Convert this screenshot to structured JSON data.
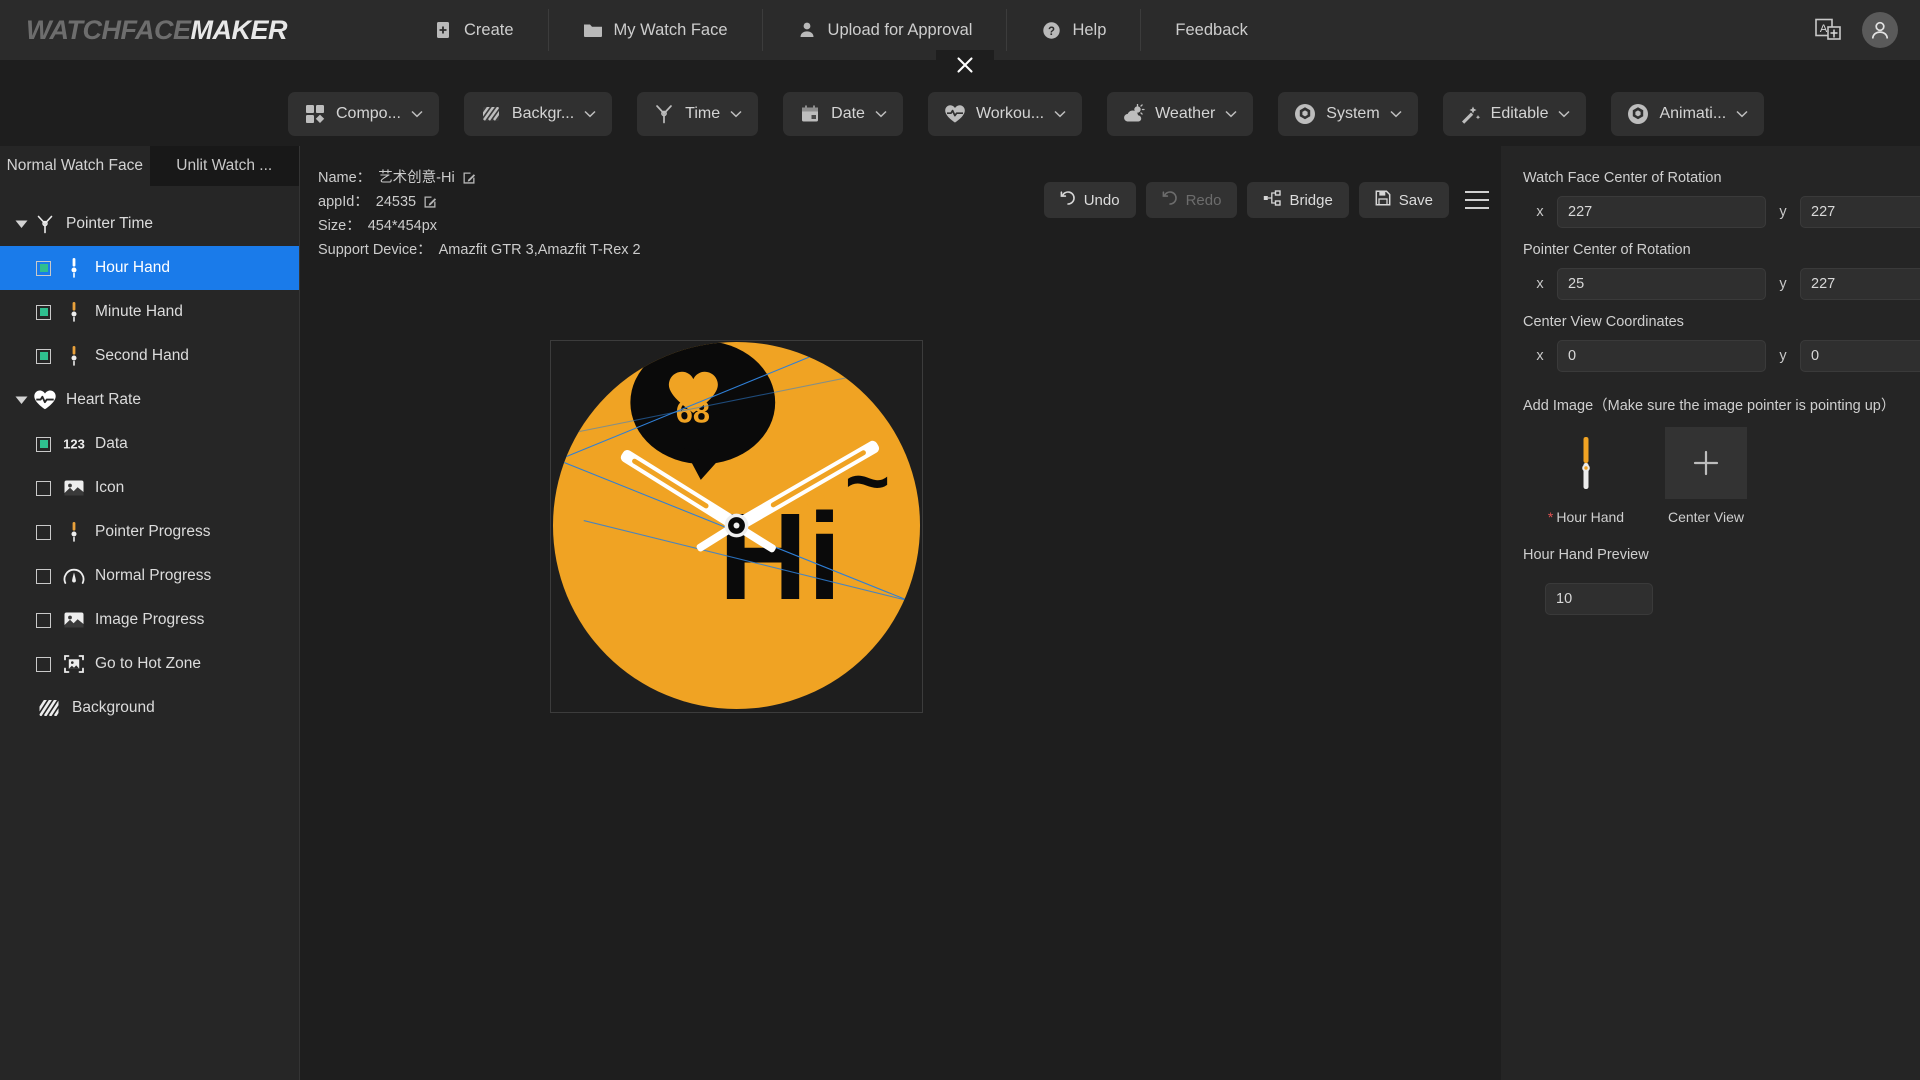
{
  "brand": {
    "part1": "WATCHFACE",
    "part2": "MAKER"
  },
  "topnav": {
    "items": [
      {
        "label": "Create",
        "icon": "file-plus-icon"
      },
      {
        "label": "My Watch Face",
        "icon": "folder-icon"
      },
      {
        "label": "Upload for Approval",
        "icon": "person-upload-icon"
      },
      {
        "label": "Help",
        "icon": "question-circle-icon"
      },
      {
        "label": "Feedback",
        "icon": "none"
      }
    ],
    "language_icon": "language-switch-icon",
    "account_icon": "user-avatar-icon"
  },
  "close_button": {
    "icon": "close-icon"
  },
  "toolbar": {
    "items": [
      {
        "label": "Compo...",
        "icon": "components-grid-icon",
        "caret": "⌄"
      },
      {
        "label": "Backgr...",
        "icon": "hatch-background-icon",
        "caret": "⌄"
      },
      {
        "label": "Time",
        "icon": "pointer-time-icon",
        "caret": "⌄"
      },
      {
        "label": "Date",
        "icon": "calendar-icon",
        "caret": "⌄"
      },
      {
        "label": "Workou...",
        "icon": "heartbeat-icon",
        "caret": "⌄"
      },
      {
        "label": "Weather",
        "icon": "weather-cloud-sun-icon",
        "caret": "⌄"
      },
      {
        "label": "System",
        "icon": "gear-hex-icon",
        "caret": "⌄"
      },
      {
        "label": "Editable",
        "icon": "magic-wand-icon",
        "caret": "⌄"
      },
      {
        "label": "Animati...",
        "icon": "gear-hex-icon",
        "caret": "⌄"
      }
    ]
  },
  "left_panel": {
    "tabs": [
      {
        "label": "Normal Watch Face",
        "active": true
      },
      {
        "label": "Unlit Watch ...",
        "active": false
      }
    ],
    "tree": [
      {
        "label": "Pointer Time",
        "type": "group",
        "expanded": true,
        "icon": "pointer-time-icon"
      },
      {
        "label": "Hour Hand",
        "type": "child",
        "checked": true,
        "selected": true,
        "icon": "hand-pointer-icon"
      },
      {
        "label": "Minute Hand",
        "type": "child",
        "checked": true,
        "selected": false,
        "icon": "hand-pointer-icon"
      },
      {
        "label": "Second Hand",
        "type": "child",
        "checked": true,
        "selected": false,
        "icon": "hand-pointer-icon"
      },
      {
        "label": "Heart Rate",
        "type": "group",
        "expanded": true,
        "icon": "heartbeat-icon"
      },
      {
        "label": "Data",
        "type": "child",
        "checked": true,
        "selected": false,
        "icon": "digits-123-icon"
      },
      {
        "label": "Icon",
        "type": "child",
        "checked": false,
        "selected": false,
        "icon": "image-icon"
      },
      {
        "label": "Pointer Progress",
        "type": "child",
        "checked": false,
        "selected": false,
        "icon": "hand-pointer-icon"
      },
      {
        "label": "Normal Progress",
        "type": "child",
        "checked": false,
        "selected": false,
        "icon": "gauge-icon"
      },
      {
        "label": "Image Progress",
        "type": "child",
        "checked": false,
        "selected": false,
        "icon": "image-icon"
      },
      {
        "label": "Go to Hot Zone",
        "type": "child",
        "checked": false,
        "selected": false,
        "icon": "hotzone-icon"
      },
      {
        "label": "Background",
        "type": "plain",
        "checked": null,
        "selected": false,
        "icon": "hatch-background-icon"
      }
    ]
  },
  "meta": {
    "name_label": "Name：",
    "name_value": "艺术创意-Hi",
    "appid_label": "appId：",
    "appid_value": "24535",
    "size_label": "Size：",
    "size_value": "454*454px",
    "device_label": "Support Device：",
    "device_value": "Amazfit GTR 3,Amazfit T-Rex 2",
    "edit_icon": "edit-pencil-icon"
  },
  "actions": {
    "undo": {
      "label": "Undo",
      "icon": "undo-icon",
      "disabled": false
    },
    "redo": {
      "label": "Redo",
      "icon": "redo-icon",
      "disabled": true
    },
    "bridge": {
      "label": "Bridge",
      "icon": "bridge-nodes-icon",
      "disabled": false
    },
    "save": {
      "label": "Save",
      "icon": "floppy-disk-icon",
      "disabled": false
    },
    "menu_icon": "hamburger-menu-icon"
  },
  "canvas": {
    "dial_color": "#F0A323",
    "bubble_color": "#0A0A0A",
    "accent_color": "#F0A323",
    "heart_rate_value": "68",
    "greeting_text": "Hi",
    "tilde_text": "~",
    "selection_color": "#2f7fd6",
    "hand_color": "#ffffff",
    "hand_stripe_color": "#F0A323"
  },
  "right_panel": {
    "sections": [
      {
        "label": "Watch Face Center of Rotation",
        "x_label": "x",
        "x_value": "227",
        "y_label": "y",
        "y_value": "227"
      },
      {
        "label": "Pointer Center of Rotation",
        "x_label": "x",
        "x_value": "25",
        "y_label": "y",
        "y_value": "227"
      },
      {
        "label": "Center View Coordinates",
        "x_label": "x",
        "x_value": "0",
        "y_label": "y",
        "y_value": "0"
      }
    ],
    "add_image_label": "Add Image（Make sure the image pointer is pointing up）",
    "thumbs": [
      {
        "label": "Hour Hand",
        "required": true,
        "kind": "hour-hand-preview"
      },
      {
        "label": "Center View",
        "required": false,
        "kind": "add-placeholder"
      }
    ],
    "preview_label": "Hour Hand Preview",
    "preview_value": "10"
  }
}
